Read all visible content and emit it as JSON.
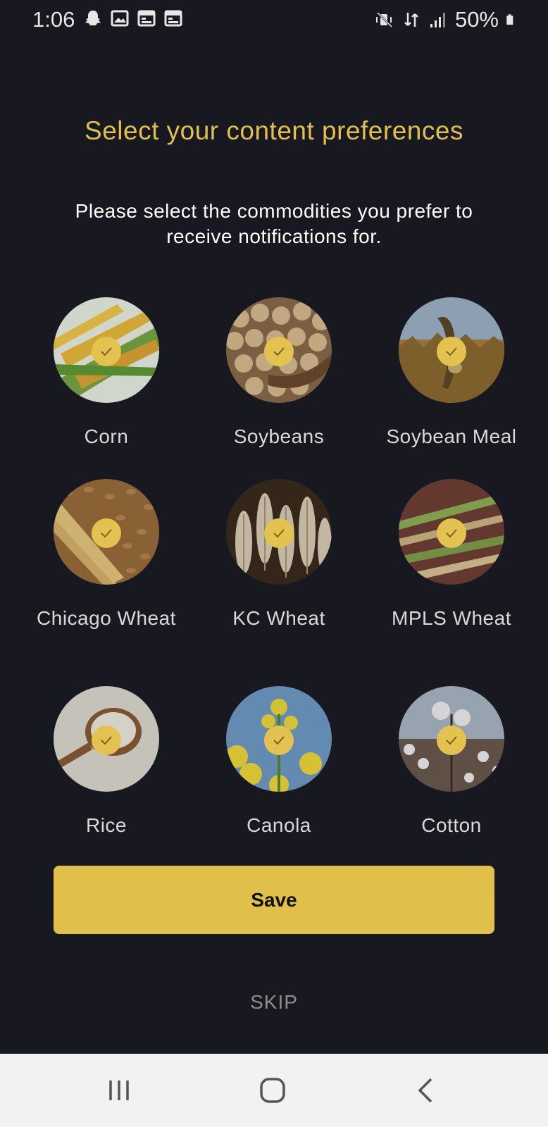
{
  "status_bar": {
    "time": "1:06",
    "battery": "50%",
    "icons_left": [
      "snapchat-icon",
      "gallery-icon",
      "calendar-icon",
      "calendar-icon"
    ],
    "icons_right": [
      "vibrate-mute-icon",
      "data-transfer-icon",
      "signal-icon",
      "battery-icon"
    ]
  },
  "header": {
    "title": "Select your content preferences",
    "subtitle": "Please select the commodities you prefer to receive notifications for."
  },
  "commodities": [
    {
      "label": "Corn",
      "selected": true
    },
    {
      "label": "Soybeans",
      "selected": true
    },
    {
      "label": "Soybean Meal",
      "selected": true
    },
    {
      "label": "Chicago Wheat",
      "selected": true
    },
    {
      "label": "KC Wheat",
      "selected": true
    },
    {
      "label": "MPLS Wheat",
      "selected": true
    },
    {
      "label": "Rice",
      "selected": true
    },
    {
      "label": "Canola",
      "selected": true
    },
    {
      "label": "Cotton",
      "selected": true
    }
  ],
  "actions": {
    "save_label": "Save",
    "skip_label": "SKIP"
  },
  "colors": {
    "background": "#181920",
    "accent": "#e0bf4a",
    "nav_bar": "#f2f2f2"
  }
}
